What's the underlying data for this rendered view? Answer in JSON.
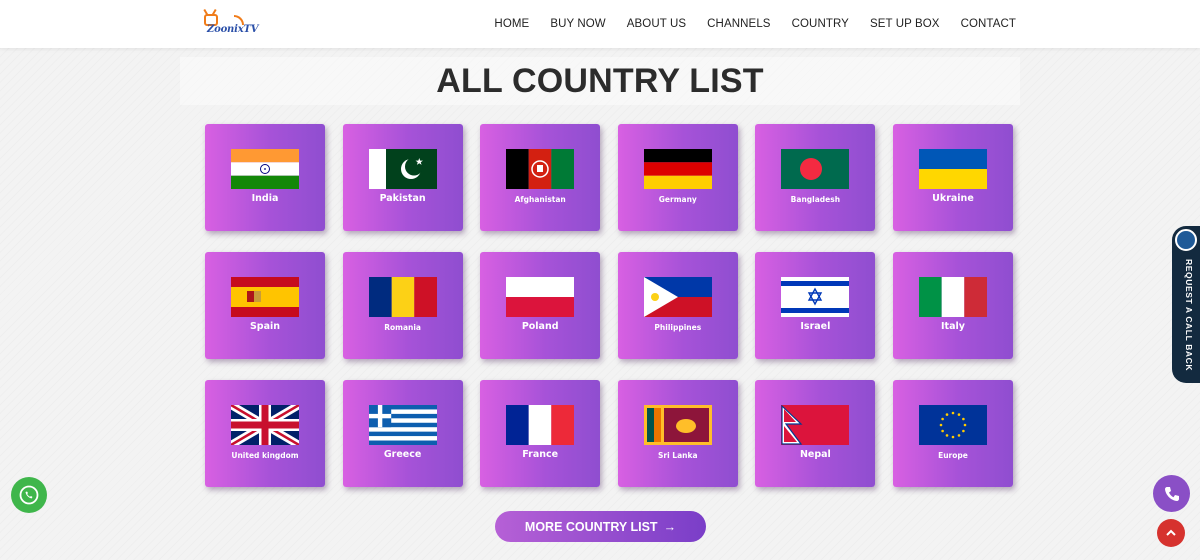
{
  "header": {
    "logo_text": "ZoonixTV",
    "nav": [
      "HOME",
      "BUY NOW",
      "ABOUT US",
      "CHANNELS",
      "COUNTRY",
      "SET UP BOX",
      "CONTACT"
    ]
  },
  "main": {
    "title": "ALL COUNTRY LIST",
    "countries": [
      {
        "label": "India",
        "flag": "india-flag"
      },
      {
        "label": "Pakistan",
        "flag": "pakistan-flag"
      },
      {
        "label": "Afghanistan",
        "flag": "afghanistan-flag"
      },
      {
        "label": "Germany",
        "flag": "germany-flag"
      },
      {
        "label": "Bangladesh",
        "flag": "bangladesh-flag"
      },
      {
        "label": "Ukraine",
        "flag": "ukraine-flag"
      },
      {
        "label": "Spain",
        "flag": "spain-flag"
      },
      {
        "label": "Romania",
        "flag": "romania-flag"
      },
      {
        "label": "Poland",
        "flag": "poland-flag"
      },
      {
        "label": "Philippines",
        "flag": "philippines-flag"
      },
      {
        "label": "Israel",
        "flag": "israel-flag"
      },
      {
        "label": "Italy",
        "flag": "italy-flag"
      },
      {
        "label": "United kingdom",
        "flag": "uk-flag"
      },
      {
        "label": "Greece",
        "flag": "greece-flag"
      },
      {
        "label": "France",
        "flag": "france-flag"
      },
      {
        "label": "Sri Lanka",
        "flag": "sri-lanka-flag"
      },
      {
        "label": "Nepal",
        "flag": "nepal-flag"
      },
      {
        "label": "Europe",
        "flag": "europe-flag"
      }
    ],
    "more_button": "MORE COUNTRY LIST",
    "more_button_arrow": "→"
  },
  "floating": {
    "callback_label": "REQUEST A CALL BACK"
  },
  "colors": {
    "card_gradient_start": "#d860e2",
    "card_gradient_end": "#8f4ed0",
    "whatsapp": "#3fb64b",
    "scroll_top": "#d6322e"
  }
}
